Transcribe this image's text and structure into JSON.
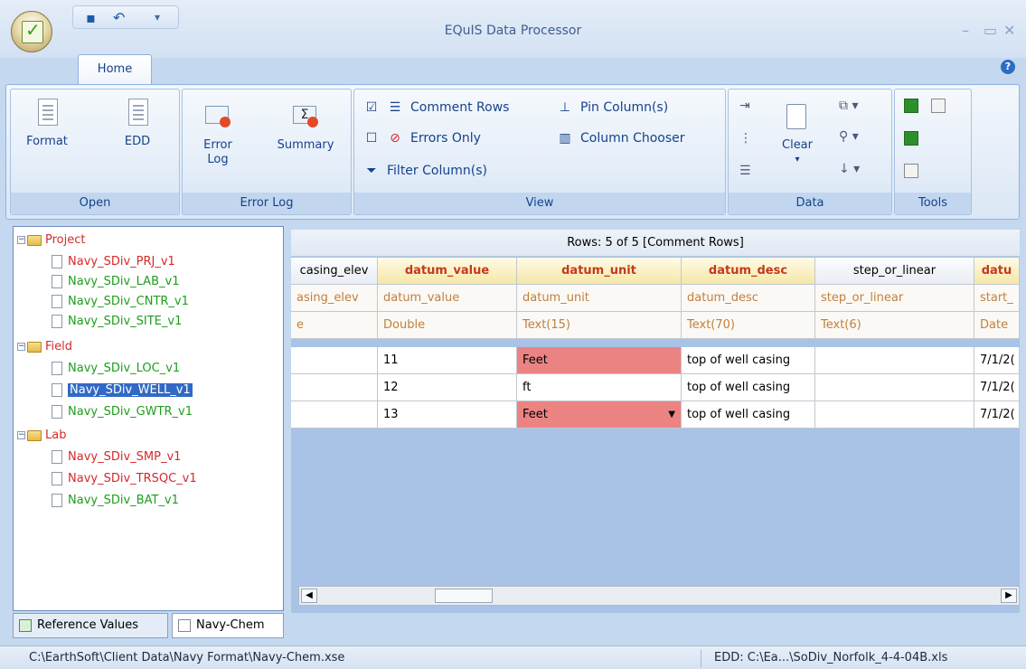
{
  "window": {
    "title": "EQuIS Data Processor"
  },
  "tabs": {
    "home": "Home"
  },
  "ribbon": {
    "open": {
      "label": "Open",
      "format": "Format",
      "edd": "EDD"
    },
    "error_log": {
      "label": "Error Log",
      "error_line1": "Error",
      "error_line2": "Log",
      "summary": "Summary"
    },
    "view": {
      "label": "View",
      "comment_rows": "Comment Rows",
      "errors_only": "Errors Only",
      "filter_columns": "Filter Column(s)",
      "pin_columns": "Pin Column(s)",
      "column_chooser": "Column Chooser"
    },
    "data": {
      "label": "Data",
      "clear": "Clear"
    },
    "tools": {
      "label": "Tools"
    }
  },
  "tree": {
    "groups": [
      {
        "name": "Project",
        "items": [
          {
            "label": "Navy_SDiv_PRJ_v1",
            "status": "red"
          },
          {
            "label": "Navy_SDiv_LAB_v1",
            "status": "green"
          },
          {
            "label": "Navy_SDiv_CNTR_v1",
            "status": "green"
          },
          {
            "label": "Navy_SDiv_SITE_v1",
            "status": "green"
          }
        ]
      },
      {
        "name": "Field",
        "items": [
          {
            "label": "Navy_SDiv_LOC_v1",
            "status": "green"
          },
          {
            "label": "Navy_SDiv_WELL_v1",
            "status": "selected"
          },
          {
            "label": "Navy_SDiv_GWTR_v1",
            "status": "green"
          }
        ]
      },
      {
        "name": "Lab",
        "items": [
          {
            "label": "Navy_SDiv_SMP_v1",
            "status": "red"
          },
          {
            "label": "Navy_SDiv_TRSQC_v1",
            "status": "red"
          },
          {
            "label": "Navy_SDiv_BAT_v1",
            "status": "green"
          }
        ]
      }
    ]
  },
  "bottom_tabs": {
    "reference": "Reference Values",
    "chem": "Navy-Chem"
  },
  "grid": {
    "rows_label": "Rows: 5 of 5  [Comment Rows]",
    "headers": [
      "casing_elev",
      "datum_value",
      "datum_unit",
      "datum_desc",
      "step_or_linear",
      "datu"
    ],
    "subheaders": [
      "asing_elev",
      "datum_value",
      "datum_unit",
      "datum_desc",
      "step_or_linear",
      "start_"
    ],
    "types": [
      "e",
      "Double",
      "Text(15)",
      "Text(70)",
      "Text(6)",
      "Date"
    ],
    "rows": [
      [
        "",
        "11",
        "Feet",
        "top of well casing",
        "",
        "7/1/2("
      ],
      [
        "",
        "12",
        "ft",
        "top of well casing",
        "",
        "7/1/2("
      ],
      [
        "",
        "13",
        "Feet",
        "top of well casing",
        "",
        "7/1/2("
      ]
    ]
  },
  "status": {
    "left": "C:\\EarthSoft\\Client Data\\Navy Format\\Navy-Chem.xse",
    "right": "EDD: C:\\Ea...\\SoDiv_Norfolk_4-4-04B.xls"
  }
}
